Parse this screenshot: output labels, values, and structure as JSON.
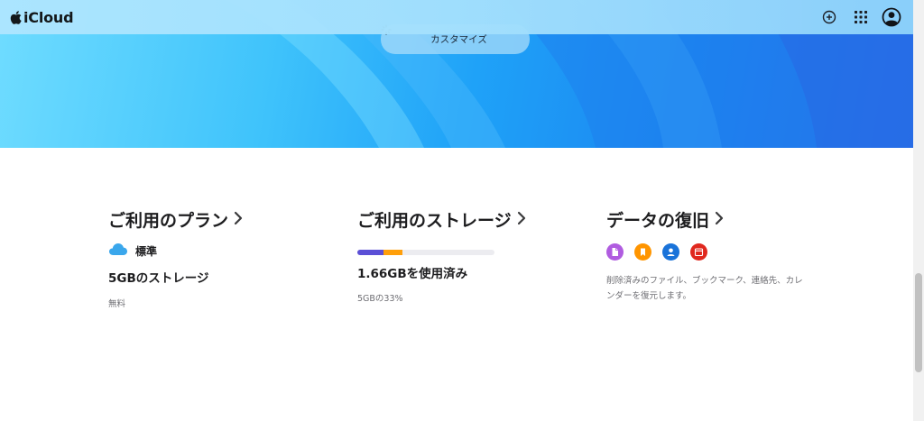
{
  "header": {
    "app_name": "iCloud",
    "icons": [
      "plus-circle-icon",
      "app-grid-icon",
      "account-icon"
    ]
  },
  "hero": {
    "customize_label": "カスタマイズ"
  },
  "plan": {
    "title": "ご利用のプラン",
    "plan_name": "標準",
    "storage_label": "5GBのストレージ",
    "price": "無料"
  },
  "storage": {
    "title": "ご利用のストレージ",
    "used_label": "1.66GBを使用済み",
    "percent_label": "5GBの33%",
    "used_fraction": 0.33,
    "segments": [
      {
        "name": "segment-a",
        "fraction": 0.19,
        "color": "#5b4fd6"
      },
      {
        "name": "segment-b",
        "fraction": 0.14,
        "color": "#ff9f0a"
      }
    ]
  },
  "recovery": {
    "title": "データの復旧",
    "icons": [
      {
        "name": "files-icon",
        "color": "#b05ce0"
      },
      {
        "name": "bookmarks-icon",
        "color": "#ff9500"
      },
      {
        "name": "contacts-icon",
        "color": "#1a73d9"
      },
      {
        "name": "calendar-icon",
        "color": "#e0281e"
      }
    ],
    "description": "削除済みのファイル、ブックマーク、連絡先、カレンダーを復元します。"
  },
  "colors": {
    "accent": "#1b86f0",
    "cloud": "#3aa7ec"
  }
}
